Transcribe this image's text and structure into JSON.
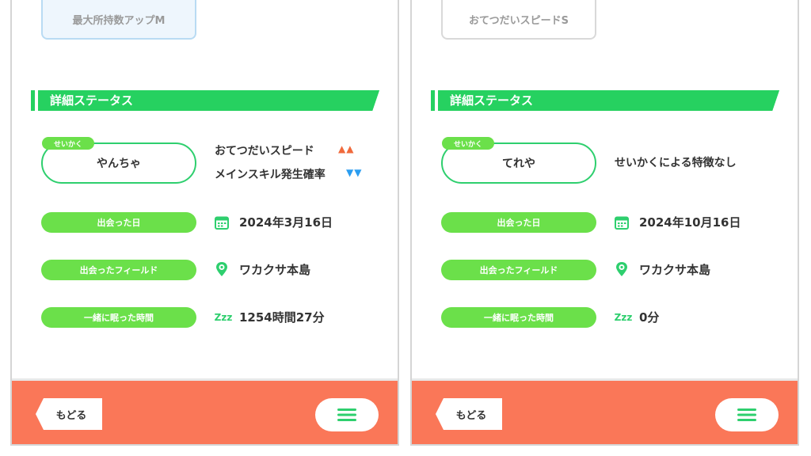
{
  "panels": [
    {
      "skill_tag": "最大所持数アップM",
      "section_title": "詳細ステータス",
      "nature_label": "せいかく",
      "nature_value": "やんちゃ",
      "effects": [
        {
          "text": "おてつだいスピード",
          "arrows": "▲▲",
          "direction": "up"
        },
        {
          "text": "メインスキル発生確率",
          "arrows": "▼▼",
          "direction": "down"
        }
      ],
      "met_date_label": "出会った日",
      "met_date_value": "2024年3月16日",
      "met_field_label": "出会ったフィールド",
      "met_field_value": "ワカクサ本島",
      "sleep_time_label": "一緒に眠った時間",
      "sleep_time_value": "1254時間27分",
      "sleep_icon": "Zzz",
      "back_label": "もどる"
    },
    {
      "skill_tag": "おてつだいスピードS",
      "section_title": "詳細ステータス",
      "nature_label": "せいかく",
      "nature_value": "てれや",
      "effect_none": "せいかくによる特徴なし",
      "met_date_label": "出会った日",
      "met_date_value": "2024年10月16日",
      "met_field_label": "出会ったフィールド",
      "met_field_value": "ワカクサ本島",
      "sleep_time_label": "一緒に眠った時間",
      "sleep_time_value": "0分",
      "sleep_icon": "Zzz",
      "back_label": "もどる"
    }
  ],
  "colors": {
    "accent_green": "#26d160",
    "pill_green": "#6be04a",
    "footer_orange": "#fa7758",
    "arrow_up": "#f06a3c",
    "arrow_down": "#2b9df0"
  },
  "icons": {
    "calendar": "calendar-icon",
    "field": "map-pin-icon",
    "sleep": "sleep-zzz-icon",
    "menu": "hamburger-menu-icon",
    "back": "back-arrow-icon"
  }
}
